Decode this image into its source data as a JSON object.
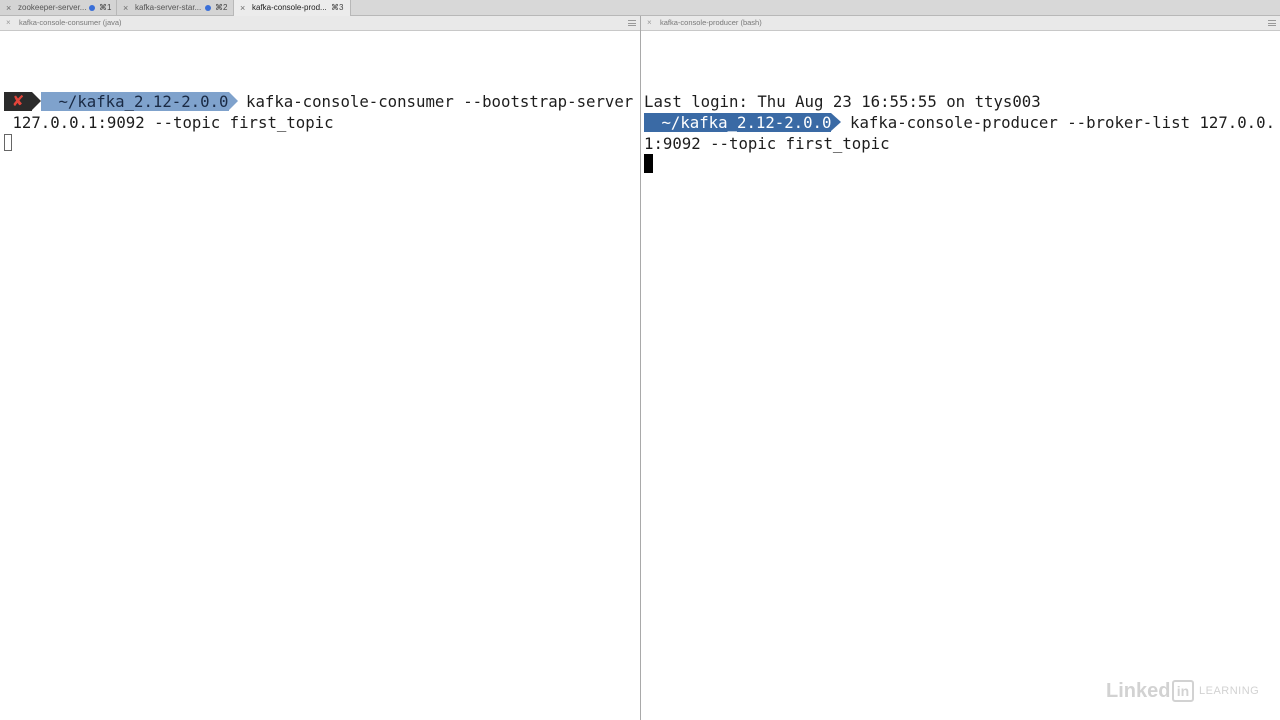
{
  "tabs": [
    {
      "label": "zookeeper-server...",
      "shortcut": "⌘1",
      "active": false,
      "has_dot": true
    },
    {
      "label": "kafka-server-star...",
      "shortcut": "⌘2",
      "active": false,
      "has_dot": true
    },
    {
      "label": "kafka-console-prod...",
      "shortcut": "⌘3",
      "active": true,
      "has_dot": false
    }
  ],
  "left_pane": {
    "title": "kafka-console-consumer (java)",
    "prompt_status": "✘",
    "prompt_dir": " ~/kafka_2.12-2.0.0 ",
    "command_line1": "kafka-console-consumer --bootstrap-server",
    "command_line2": " 127.0.0.1:9092 --topic first_topic"
  },
  "right_pane": {
    "title": "kafka-console-producer (bash)",
    "last_login": "Last login: Thu Aug 23 16:55:55 on ttys003",
    "prompt_dir": " ~/kafka_2.12-2.0.0 ",
    "command_line1": "kafka-console-producer --broker-list 127.0.0.",
    "command_line2": "1:9092 --topic first_topic"
  },
  "icons": {
    "close": "×",
    "pane_menu": "hamburger-icon"
  },
  "watermark": {
    "linked": "Linked",
    "in": "in",
    "learning": "LEARNING"
  },
  "colors": {
    "prompt_dir_light": "#7fa2cc",
    "prompt_dir_dark": "#3a6aa5",
    "prompt_status_bg": "#2b2b2b",
    "prompt_status_fg": "#e2443a",
    "tab_dot": "#3a6fd8"
  }
}
